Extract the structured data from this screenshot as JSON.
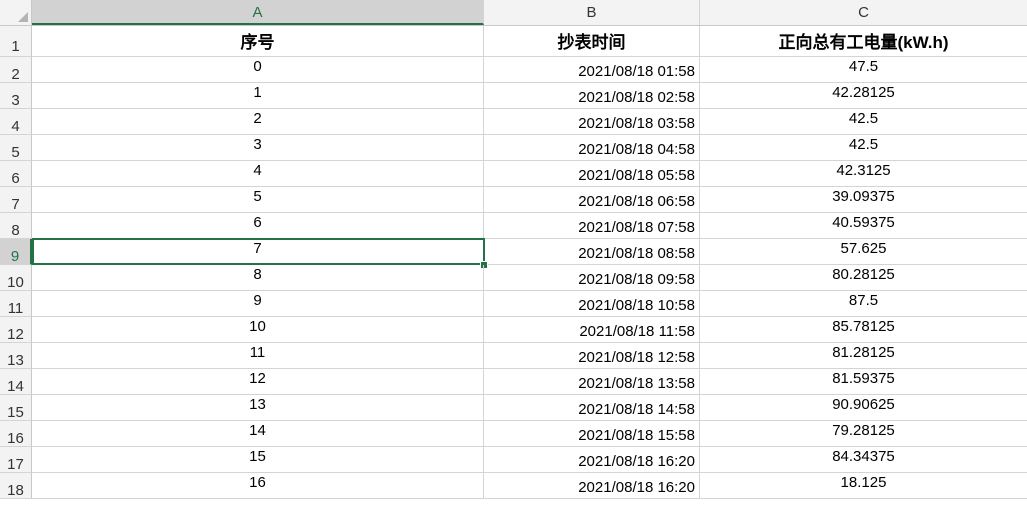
{
  "columns": [
    "A",
    "B",
    "C"
  ],
  "selected_column": "A",
  "selected_row": 9,
  "header_row": {
    "row_number": "1",
    "seq": "序号",
    "time": "抄表时间",
    "energy": "正向总有工电量(kW.h)"
  },
  "rows": [
    {
      "row_number": "2",
      "seq": "0",
      "time": "2021/08/18 01:58",
      "energy": "47.5"
    },
    {
      "row_number": "3",
      "seq": "1",
      "time": "2021/08/18 02:58",
      "energy": "42.28125"
    },
    {
      "row_number": "4",
      "seq": "2",
      "time": "2021/08/18 03:58",
      "energy": "42.5"
    },
    {
      "row_number": "5",
      "seq": "3",
      "time": "2021/08/18 04:58",
      "energy": "42.5"
    },
    {
      "row_number": "6",
      "seq": "4",
      "time": "2021/08/18 05:58",
      "energy": "42.3125"
    },
    {
      "row_number": "7",
      "seq": "5",
      "time": "2021/08/18 06:58",
      "energy": "39.09375"
    },
    {
      "row_number": "8",
      "seq": "6",
      "time": "2021/08/18 07:58",
      "energy": "40.59375"
    },
    {
      "row_number": "9",
      "seq": "7",
      "time": "2021/08/18 08:58",
      "energy": "57.625"
    },
    {
      "row_number": "10",
      "seq": "8",
      "time": "2021/08/18 09:58",
      "energy": "80.28125"
    },
    {
      "row_number": "11",
      "seq": "9",
      "time": "2021/08/18 10:58",
      "energy": "87.5"
    },
    {
      "row_number": "12",
      "seq": "10",
      "time": "2021/08/18 11:58",
      "energy": "85.78125"
    },
    {
      "row_number": "13",
      "seq": "11",
      "time": "2021/08/18 12:58",
      "energy": "81.28125"
    },
    {
      "row_number": "14",
      "seq": "12",
      "time": "2021/08/18 13:58",
      "energy": "81.59375"
    },
    {
      "row_number": "15",
      "seq": "13",
      "time": "2021/08/18 14:58",
      "energy": "90.90625"
    },
    {
      "row_number": "16",
      "seq": "14",
      "time": "2021/08/18 15:58",
      "energy": "79.28125"
    },
    {
      "row_number": "17",
      "seq": "15",
      "time": "2021/08/18 16:20",
      "energy": "84.34375"
    },
    {
      "row_number": "18",
      "seq": "16",
      "time": "2021/08/18 16:20",
      "energy": "18.125"
    }
  ],
  "colors": {
    "accent": "#217346",
    "header_bg": "#f3f3f3",
    "selected_header_bg": "#d2d2d2",
    "gridline": "#d4d4d4"
  }
}
